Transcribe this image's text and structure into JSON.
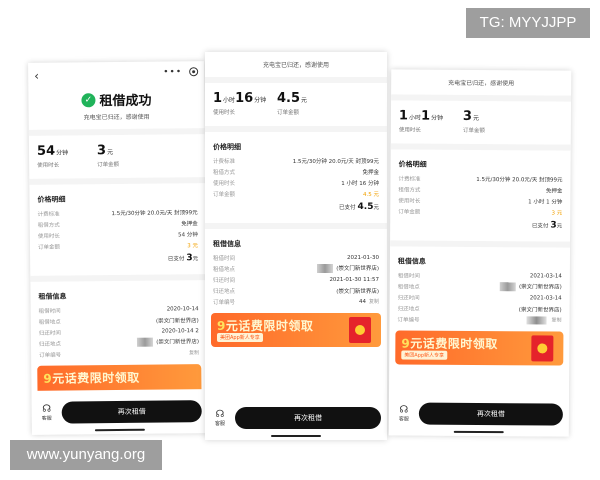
{
  "watermarks": {
    "tg": "TG: MYYJJPP",
    "url": "www.yunyang.org"
  },
  "p1": {
    "status_title": "租借成功",
    "status_sub": "充电宝已归还，感谢使用",
    "stats": [
      {
        "value": "54",
        "unit": "分钟",
        "label": "使用时长"
      },
      {
        "value": "3",
        "unit": "元",
        "label": "订单金额"
      }
    ],
    "price_title": "价格明细",
    "price_rows": [
      {
        "label": "计费标准",
        "value": "1.5元/30分钟 20.0元/天 封顶99元"
      },
      {
        "label": "租借方式",
        "value": "免押金"
      },
      {
        "label": "使用时长",
        "value": "54 分钟"
      },
      {
        "label": "订单金额",
        "value": "3 元"
      }
    ],
    "paid_label": "已支付",
    "paid_amount": "3",
    "paid_unit": "元",
    "rent_title": "租借信息",
    "rent_rows": [
      {
        "label": "租借时间",
        "value": "2020-10-14"
      },
      {
        "label": "租借地点",
        "value": "(崇文门新世界店)"
      },
      {
        "label": "归还时间",
        "value": "2020-10-14 2"
      },
      {
        "label": "归还地点",
        "value": "(崇文门新世界店)"
      },
      {
        "label": "订单编号",
        "value": "复制"
      }
    ],
    "promo_nine": "9",
    "promo_title": "元话费限时领取",
    "service_label": "客服",
    "rent_again": "再次租借"
  },
  "p2": {
    "status_sub": "充电宝已归还，感谢使用",
    "stats": [
      {
        "value": "1",
        "unit": "小时",
        "value2": "16",
        "unit2": "分钟",
        "label": "使用时长"
      },
      {
        "value": "4.5",
        "unit": "元",
        "label": "订单金额"
      }
    ],
    "price_title": "价格明细",
    "price_rows": [
      {
        "label": "计费标准",
        "value": "1.5元/30分钟 20.0元/天 封顶99元"
      },
      {
        "label": "租借方式",
        "value": "免押金"
      },
      {
        "label": "使用时长",
        "value": "1 小时 16 分钟"
      },
      {
        "label": "订单金额",
        "value": "4.5 元"
      }
    ],
    "paid_label": "已支付",
    "paid_amount": "4.5",
    "paid_unit": "元",
    "rent_title": "租借信息",
    "rent_rows": [
      {
        "label": "租借时间",
        "value": "2021-01-30"
      },
      {
        "label": "租借地点",
        "value": "(崇文门新世界店)"
      },
      {
        "label": "归还时间",
        "value": "2021-01-30 11:57"
      },
      {
        "label": "归还地点",
        "value": "(崇文门新世界店)"
      },
      {
        "label": "订单编号",
        "value": "44"
      }
    ],
    "order_copy": "复制",
    "promo_nine": "9",
    "promo_title": "元话费限时领取",
    "promo_sub": "美团App新人专享",
    "service_label": "客服",
    "rent_again": "再次租借"
  },
  "p3": {
    "status_sub": "充电宝已归还，感谢使用",
    "stats": [
      {
        "value": "1",
        "unit": "小时",
        "value2": "1",
        "unit2": "分钟",
        "label": "使用时长"
      },
      {
        "value": "3",
        "unit": "元",
        "label": "订单金额"
      }
    ],
    "price_title": "价格明细",
    "price_rows": [
      {
        "label": "计费标准",
        "value": "1.5元/30分钟 20.0元/天 封顶99元"
      },
      {
        "label": "租借方式",
        "value": "免押金"
      },
      {
        "label": "使用时长",
        "value": "1 小时 1 分钟"
      },
      {
        "label": "订单金额",
        "value": "3 元"
      }
    ],
    "paid_label": "已支付",
    "paid_amount": "3",
    "paid_unit": "元",
    "rent_title": "租借信息",
    "rent_rows": [
      {
        "label": "租借时间",
        "value": "2021-03-14"
      },
      {
        "label": "租借地点",
        "value": "(崇文门新世界店)"
      },
      {
        "label": "归还时间",
        "value": "2021-03-14"
      },
      {
        "label": "归还地点",
        "value": "(崇文门新世界店)"
      },
      {
        "label": "订单编号",
        "value": ""
      }
    ],
    "order_copy": "复制",
    "promo_nine": "9",
    "promo_title": "元话费限时领取",
    "promo_sub": "美团App新人专享",
    "service_label": "客服",
    "rent_again": "再次租借"
  },
  "colors": {
    "success": "#20b35a",
    "accent_orange": "#f2a100",
    "promo": "#ff6a2a",
    "button": "#111111"
  }
}
